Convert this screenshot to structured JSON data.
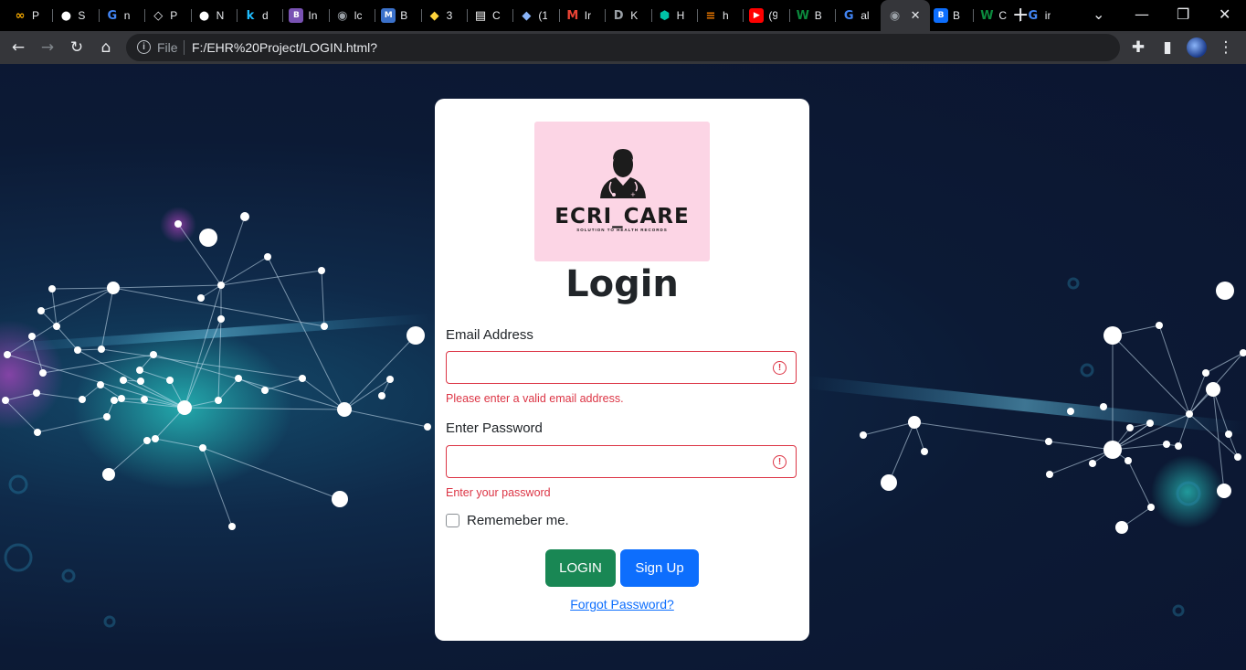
{
  "browser": {
    "tabs": [
      {
        "favicon": "colab-icon",
        "label": "P",
        "color": "#f9ab00"
      },
      {
        "favicon": "github-icon",
        "label": "S",
        "color": "#ffffff"
      },
      {
        "favicon": "google-icon",
        "label": "n",
        "color": "#4285f4"
      },
      {
        "favicon": "app-icon",
        "label": "P",
        "color": "#e8eaed"
      },
      {
        "favicon": "github-icon",
        "label": "N",
        "color": "#ffffff"
      },
      {
        "favicon": "kaggle-icon",
        "label": "d",
        "color": "#20beff"
      },
      {
        "favicon": "bootstrap-icon",
        "label": "In",
        "color": "#7952b3"
      },
      {
        "favicon": "globe-icon",
        "label": "lc",
        "color": "#9aa0a6"
      },
      {
        "favicon": "mdb-icon",
        "label": "B",
        "color": "#3b71ca"
      },
      {
        "favicon": "python-icon",
        "label": "3",
        "color": "#ffd43b"
      },
      {
        "favicon": "terminal-icon",
        "label": "C",
        "color": "#ffffff"
      },
      {
        "favicon": "cloud-icon",
        "label": "(1",
        "color": "#8ab4f8"
      },
      {
        "favicon": "gmail-icon",
        "label": "Ir",
        "color": "#ea4335"
      },
      {
        "favicon": "doc-icon",
        "label": "K",
        "color": "#9aa0a6"
      },
      {
        "favicon": "hex-icon",
        "label": "H",
        "color": "#00c4a7"
      },
      {
        "favicon": "chart-icon",
        "label": "h",
        "color": "#e37400"
      },
      {
        "favicon": "youtube-icon",
        "label": "(9",
        "color": "#ff0000"
      },
      {
        "favicon": "w-icon",
        "label": "B",
        "color": "#0b8a3d"
      },
      {
        "favicon": "google-icon",
        "label": "al",
        "color": "#4285f4"
      },
      {
        "favicon": "globe-icon",
        "label": "",
        "color": "#9aa0a6"
      },
      {
        "favicon": "b-icon",
        "label": "B",
        "color": "#0d6efd"
      },
      {
        "favicon": "w-icon",
        "label": "C",
        "color": "#0b8a3d"
      },
      {
        "favicon": "google-icon",
        "label": "ir",
        "color": "#4285f4"
      }
    ],
    "address": {
      "scheme_label": "File",
      "url": "F:/EHR%20Project/LOGIN.html?"
    }
  },
  "login": {
    "logo": {
      "brand": "ECRI_CARE",
      "tagline": "SOLUTION TO HEALTH RECORDS"
    },
    "title": "Login",
    "email": {
      "label": "Email Address",
      "value": "",
      "error": "Please enter a valid email address."
    },
    "password": {
      "label": "Enter Password",
      "value": "",
      "error": "Enter your password"
    },
    "remember_label": "Rememeber me.",
    "login_button": "LOGIN",
    "signup_button": "Sign Up",
    "forgot_link": "Forgot Password?",
    "colors": {
      "login_button": "#198754",
      "signup_button": "#0d6efd",
      "error": "#dc3545",
      "logo_background": "#fcd5e5"
    }
  }
}
